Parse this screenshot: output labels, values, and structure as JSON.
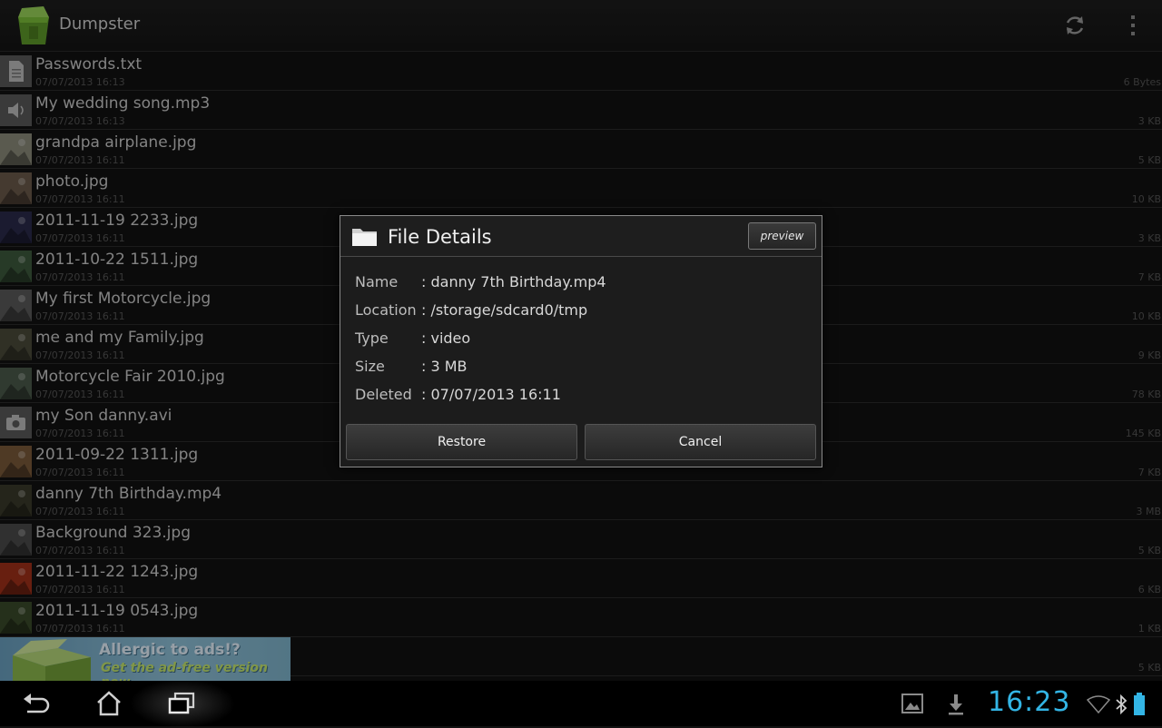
{
  "app": {
    "title": "Dumpster"
  },
  "files": [
    {
      "name": "Passwords.txt",
      "date": "07/07/2013 16:13",
      "size": "6 Bytes",
      "thumb": "doc-icon"
    },
    {
      "name": "My wedding song.mp3",
      "date": "07/07/2013 16:13",
      "size": "3 KB",
      "thumb": "audio-icon"
    },
    {
      "name": "grandpa airplane.jpg",
      "date": "07/07/2013 16:11",
      "size": "5 KB",
      "thumb": "image-thumb"
    },
    {
      "name": "photo.jpg",
      "date": "07/07/2013 16:11",
      "size": "10 KB",
      "thumb": "image-thumb"
    },
    {
      "name": "2011-11-19 2233.jpg",
      "date": "07/07/2013 16:11",
      "size": "3 KB",
      "thumb": "image-thumb"
    },
    {
      "name": "2011-10-22 1511.jpg",
      "date": "07/07/2013 16:11",
      "size": "7 KB",
      "thumb": "image-thumb"
    },
    {
      "name": "My first Motorcycle.jpg",
      "date": "07/07/2013 16:11",
      "size": "10 KB",
      "thumb": "image-thumb"
    },
    {
      "name": "me and my Family.jpg",
      "date": "07/07/2013 16:11",
      "size": "9 KB",
      "thumb": "image-thumb"
    },
    {
      "name": "Motorcycle Fair 2010.jpg",
      "date": "07/07/2013 16:11",
      "size": "78 KB",
      "thumb": "image-thumb"
    },
    {
      "name": "my Son danny.avi",
      "date": "07/07/2013 16:11",
      "size": "145 KB",
      "thumb": "camera-icon"
    },
    {
      "name": "2011-09-22 1311.jpg",
      "date": "07/07/2013 16:11",
      "size": "7 KB",
      "thumb": "image-thumb"
    },
    {
      "name": "danny 7th Birthday.mp4",
      "date": "07/07/2013 16:11",
      "size": "3 MB",
      "thumb": "image-thumb"
    },
    {
      "name": "Background  323.jpg",
      "date": "07/07/2013 16:11",
      "size": "5 KB",
      "thumb": "image-thumb"
    },
    {
      "name": "2011-11-22 1243.jpg",
      "date": "07/07/2013 16:11",
      "size": "6 KB",
      "thumb": "image-thumb"
    },
    {
      "name": "2011-11-19 0543.jpg",
      "date": "07/07/2013 16:11",
      "size": "1 KB",
      "thumb": "image-thumb"
    },
    {
      "name": "",
      "date": "",
      "size": "5 KB",
      "thumb": ""
    }
  ],
  "ad": {
    "line1": "Allergic to ads!?",
    "line2": "Get the ad-free version now"
  },
  "dialog": {
    "title": "File Details",
    "preview_label": "preview",
    "details": [
      {
        "label": "Name",
        "value": ": danny 7th Birthday.mp4"
      },
      {
        "label": "Location",
        "value": ": /storage/sdcard0/tmp"
      },
      {
        "label": "Type",
        "value": ": video"
      },
      {
        "label": "Size",
        "value": ": 3 MB"
      },
      {
        "label": "Deleted",
        "value": ": 07/07/2013 16:11"
      }
    ],
    "restore_label": "Restore",
    "cancel_label": "Cancel"
  },
  "system": {
    "clock": "16:23",
    "accent": "#33b5e5"
  }
}
